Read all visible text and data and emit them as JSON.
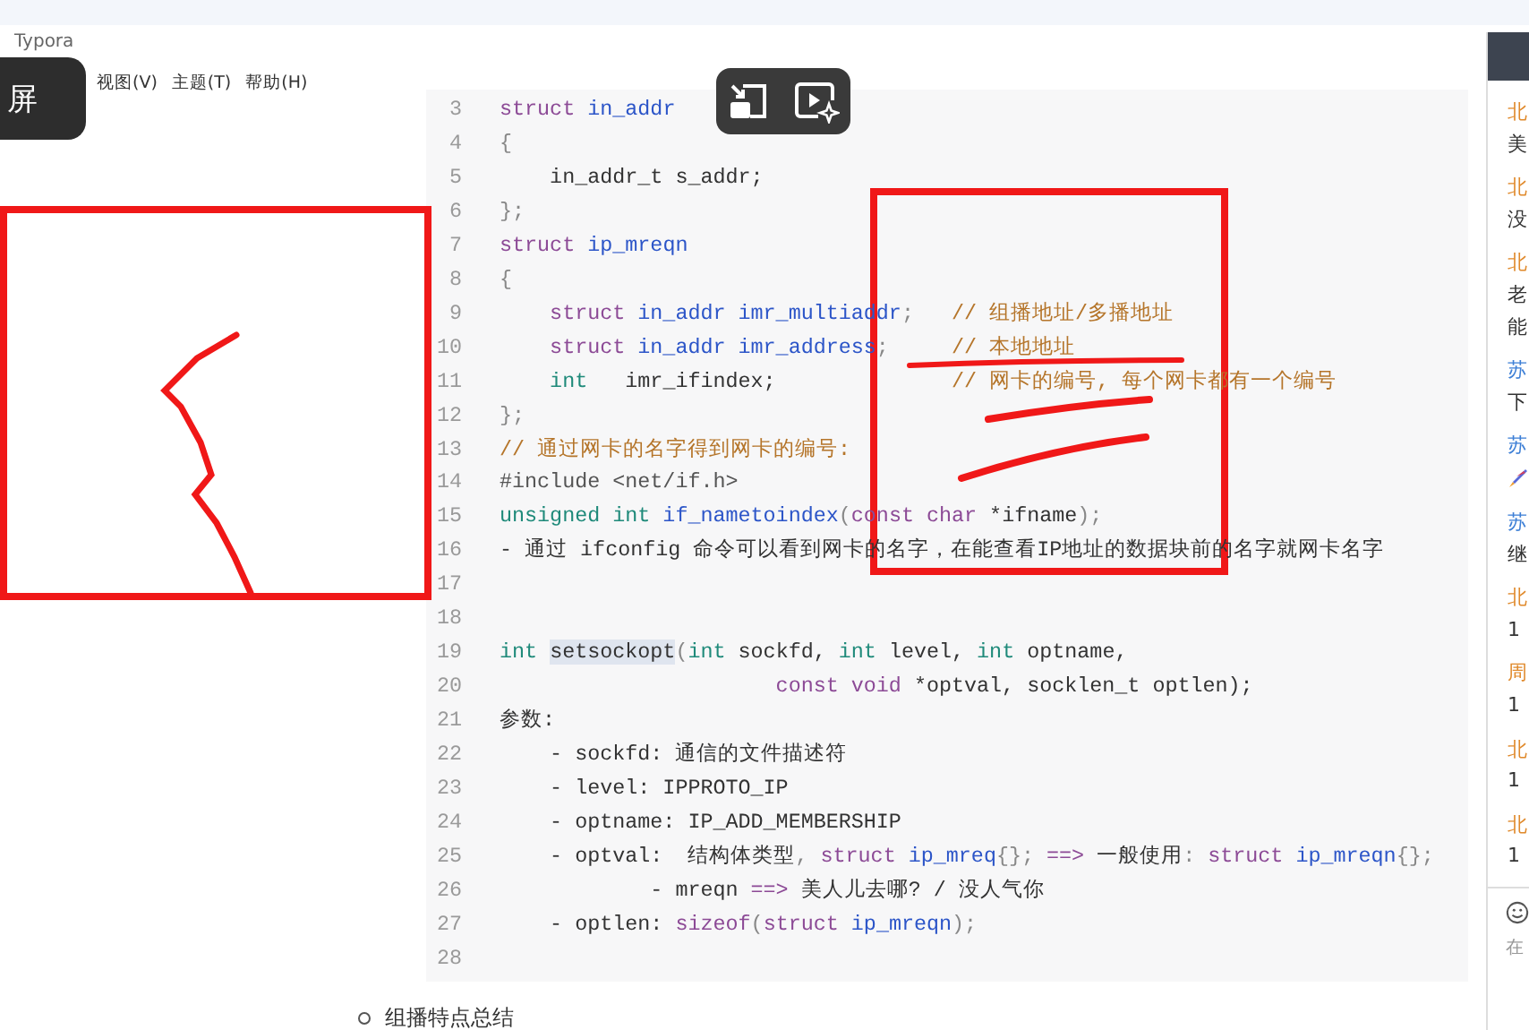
{
  "window": {
    "title": "Typora"
  },
  "overlay_button": {
    "label": "屏"
  },
  "menu": [
    "视图(V)",
    "主题(T)",
    "帮助(H)"
  ],
  "code_lines": [
    {
      "number": "3",
      "tokens": [
        {
          "kind": "keyword",
          "text": "struct"
        },
        {
          "kind": "name",
          "text": " in_addr"
        }
      ]
    },
    {
      "number": "4",
      "tokens": [
        {
          "kind": "punct",
          "text": "{"
        }
      ]
    },
    {
      "number": "5",
      "tokens": [
        {
          "kind": "plain",
          "text": "    in_addr_t s_addr;"
        }
      ]
    },
    {
      "number": "6",
      "tokens": [
        {
          "kind": "punct",
          "text": "};"
        }
      ]
    },
    {
      "number": "7",
      "tokens": [
        {
          "kind": "keyword",
          "text": "struct"
        },
        {
          "kind": "name",
          "text": " ip_mreqn"
        }
      ]
    },
    {
      "number": "8",
      "tokens": [
        {
          "kind": "punct",
          "text": "{"
        }
      ]
    },
    {
      "number": "9",
      "tokens": [
        {
          "kind": "keyword",
          "text": "    struct"
        },
        {
          "kind": "name",
          "text": " in_addr imr_multiaddr"
        },
        {
          "kind": "punct",
          "text": ";"
        },
        {
          "kind": "comment",
          "text": "   // 组播地址/多播地址"
        }
      ]
    },
    {
      "number": "10",
      "tokens": [
        {
          "kind": "keyword",
          "text": "    struct"
        },
        {
          "kind": "name",
          "text": " in_addr imr_address"
        },
        {
          "kind": "punct",
          "text": ";"
        },
        {
          "kind": "comment",
          "text": "     // 本地地址"
        }
      ]
    },
    {
      "number": "11",
      "tokens": [
        {
          "kind": "primitive",
          "text": "    int"
        },
        {
          "kind": "plain",
          "text": "   imr_ifindex;"
        },
        {
          "kind": "comment",
          "text": "              // 网卡的编号, 每个网卡都有一个编号"
        }
      ]
    },
    {
      "number": "12",
      "tokens": [
        {
          "kind": "punct",
          "text": "};"
        }
      ]
    },
    {
      "number": "13",
      "tokens": [
        {
          "kind": "comment",
          "text": "// 通过网卡的名字得到网卡的编号:"
        }
      ]
    },
    {
      "number": "14",
      "tokens": [
        {
          "kind": "meta",
          "text": "#include <net/if.h>"
        }
      ]
    },
    {
      "number": "15",
      "tokens": [
        {
          "kind": "primitive",
          "text": "unsigned int"
        },
        {
          "kind": "name",
          "text": " if_nametoindex"
        },
        {
          "kind": "punct",
          "text": "("
        },
        {
          "kind": "keyword",
          "text": "const char"
        },
        {
          "kind": "plain",
          "text": " *ifname"
        },
        {
          "kind": "punct",
          "text": ");"
        }
      ]
    },
    {
      "number": "16",
      "tokens": [
        {
          "kind": "plain",
          "text": "- 通过 ifconfig 命令可以看到网卡的名字，在能查看IP地址的数据块前的名字就网卡名字"
        }
      ]
    },
    {
      "number": "17"
    },
    {
      "number": "18"
    },
    {
      "number": "19",
      "tokens": [
        {
          "kind": "primitive",
          "text": "int "
        },
        {
          "kind": "highlight",
          "text": "setsockopt"
        },
        {
          "kind": "punct",
          "text": "("
        },
        {
          "kind": "primitive",
          "text": "int"
        },
        {
          "kind": "plain",
          "text": " sockfd, "
        },
        {
          "kind": "primitive",
          "text": "int"
        },
        {
          "kind": "plain",
          "text": " level, "
        },
        {
          "kind": "primitive",
          "text": "int"
        },
        {
          "kind": "plain",
          "text": " optname,"
        }
      ]
    },
    {
      "number": "20",
      "tokens": [
        {
          "kind": "keyword",
          "text": "                      const void"
        },
        {
          "kind": "plain",
          "text": " *optval, socklen_t optlen);"
        }
      ]
    },
    {
      "number": "21",
      "tokens": [
        {
          "kind": "plain",
          "text": "参数:"
        }
      ]
    },
    {
      "number": "22",
      "tokens": [
        {
          "kind": "plain",
          "text": "    - sockfd: 通信的文件描述符"
        }
      ]
    },
    {
      "number": "23",
      "tokens": [
        {
          "kind": "plain",
          "text": "    - level: IPPROTO_IP"
        }
      ]
    },
    {
      "number": "24",
      "tokens": [
        {
          "kind": "plain",
          "text": "    - optname: IP_ADD_MEMBERSHIP"
        }
      ]
    },
    {
      "number": "25",
      "tokens": [
        {
          "kind": "plain",
          "text": "    - optval:  结构体类型"
        },
        {
          "kind": "punct",
          "text": ", "
        },
        {
          "kind": "keyword",
          "text": "struct"
        },
        {
          "kind": "name",
          "text": " ip_mreq"
        },
        {
          "kind": "punct",
          "text": "{}; "
        },
        {
          "kind": "keyword",
          "text": "==>"
        },
        {
          "kind": "plain",
          "text": " 一般使用"
        },
        {
          "kind": "punct",
          "text": ": "
        },
        {
          "kind": "keyword",
          "text": "struct"
        },
        {
          "kind": "name",
          "text": " ip_mreqn"
        },
        {
          "kind": "punct",
          "text": "{};"
        }
      ]
    },
    {
      "number": "26",
      "tokens": [
        {
          "kind": "plain",
          "text": "            - mreqn "
        },
        {
          "kind": "keyword",
          "text": "==>"
        },
        {
          "kind": "plain",
          "text": " 美人儿去哪? / 没人气你"
        }
      ]
    },
    {
      "number": "27",
      "tokens": [
        {
          "kind": "plain",
          "text": "    - optlen: "
        },
        {
          "kind": "keyword",
          "text": "sizeof"
        },
        {
          "kind": "punct",
          "text": "("
        },
        {
          "kind": "keyword",
          "text": "struct"
        },
        {
          "kind": "name",
          "text": " ip_mreqn"
        },
        {
          "kind": "punct",
          "text": ");"
        }
      ]
    },
    {
      "number": "28"
    }
  ],
  "outline_item": {
    "text": "组播特点总结"
  },
  "comments": [
    {
      "kind": "text",
      "author": "北",
      "color": "#e08a2c",
      "lines": [
        "美"
      ]
    },
    {
      "kind": "text",
      "author": "北",
      "color": "#e08a2c",
      "lines": [
        "没"
      ]
    },
    {
      "kind": "text",
      "author": "北",
      "color": "#e08a2c",
      "lines": [
        "老",
        "能"
      ]
    },
    {
      "kind": "text",
      "author": "苏",
      "color": "#3d7fd6",
      "lines": [
        "下"
      ]
    },
    {
      "kind": "emoji",
      "author": "苏",
      "color": "#3d7fd6"
    },
    {
      "kind": "text",
      "author": "苏",
      "color": "#3d7fd6",
      "lines": [
        "继"
      ]
    },
    {
      "kind": "text",
      "author": "北",
      "color": "#e08a2c",
      "lines": [
        "1"
      ]
    },
    {
      "kind": "text",
      "author": "周",
      "color": "#e08a2c",
      "lines": [
        "1"
      ]
    },
    {
      "kind": "text",
      "author": "北",
      "color": "#e08a2c",
      "lines": [
        "1"
      ]
    },
    {
      "kind": "text",
      "author": "北",
      "color": "#e08a2c",
      "lines": [
        "1"
      ]
    }
  ],
  "comment_input": {
    "placeholder": "在"
  }
}
